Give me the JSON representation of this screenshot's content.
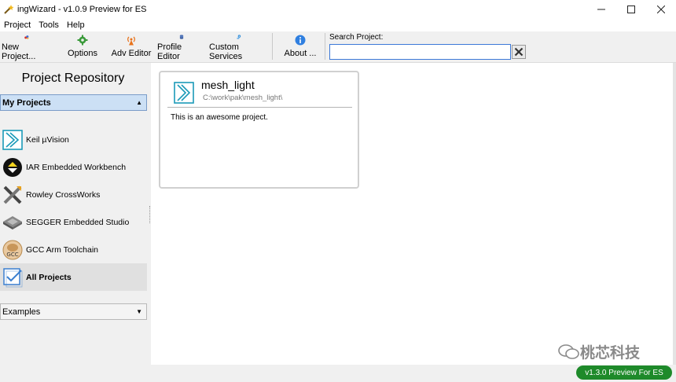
{
  "window": {
    "title": "ingWizard - v1.0.9 Preview for ES"
  },
  "menu": [
    "Project",
    "Tools",
    "Help"
  ],
  "toolbar": {
    "new_project": "New Project...",
    "options": "Options",
    "adv_editor": "Adv Editor",
    "profile_editor": "Profile Editor",
    "custom_services": "Custom Services",
    "about": "About ..."
  },
  "search": {
    "label": "Search Project:",
    "value": ""
  },
  "sidebar": {
    "title": "Project Repository",
    "my_projects": "My Projects",
    "tools": [
      {
        "label": "Keil µVision",
        "icon": "keil-icon"
      },
      {
        "label": "IAR Embedded Workbench",
        "icon": "iar-icon"
      },
      {
        "label": "Rowley CrossWorks",
        "icon": "rowley-icon"
      },
      {
        "label": "SEGGER Embedded Studio",
        "icon": "segger-icon"
      },
      {
        "label": "GCC Arm Toolchain",
        "icon": "gcc-icon"
      },
      {
        "label": "All Projects",
        "icon": "all-projects-icon",
        "selected": true
      }
    ],
    "examples": "Examples"
  },
  "project_card": {
    "name": "mesh_light",
    "path": "C:\\work\\pak\\mesh_light\\",
    "description": "This is an awesome project."
  },
  "status": {
    "version": "v1.3.0 Preview For ES"
  },
  "watermark": "桃芯科技",
  "colors": {
    "accent": "#3c78d8",
    "selected_header": "#cce0f5",
    "version_green": "#1e8a2a",
    "keil_teal": "#1b9ab8"
  }
}
